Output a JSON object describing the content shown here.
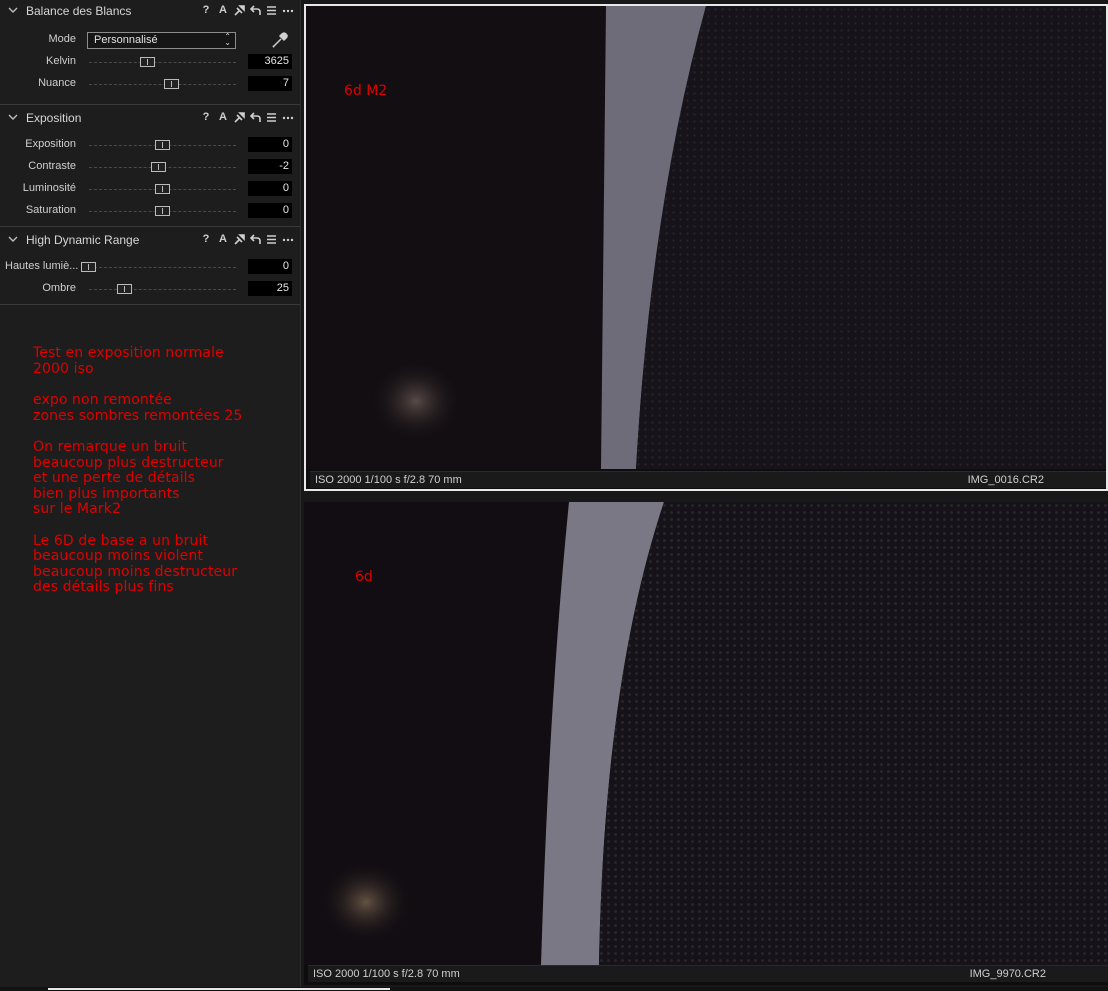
{
  "white_balance": {
    "title": "Balance des Blancs",
    "mode_label": "Mode",
    "mode_value": "Personnalisé",
    "kelvin_label": "Kelvin",
    "kelvin_value": "3625",
    "nuance_label": "Nuance",
    "nuance_value": "7"
  },
  "exposure": {
    "title": "Exposition",
    "exposition_label": "Exposition",
    "exposition_value": "0",
    "contraste_label": "Contraste",
    "contraste_value": "-2",
    "luminosite_label": "Luminosité",
    "luminosite_value": "0",
    "saturation_label": "Saturation",
    "saturation_value": "0"
  },
  "hdr": {
    "title": "High Dynamic Range",
    "hautes_label": "Hautes lumiè...",
    "hautes_value": "0",
    "ombre_label": "Ombre",
    "ombre_value": "25"
  },
  "tool_icons": [
    "help-icon",
    "auto-icon",
    "copy-apply-icon",
    "reset-icon",
    "menu-icon",
    "more-icon"
  ],
  "tool_icon_text": {
    "help": "?",
    "auto": "A"
  },
  "notes": [
    [
      "Test en exposition normale",
      "2000 iso"
    ],
    [
      "expo non remontée",
      "zones sombres remontées 25"
    ],
    [
      "On remarque un bruit",
      "beaucoup plus destructeur",
      "et une perte de détails",
      "bien plus importants",
      "sur le Mark2"
    ],
    [
      "Le 6D de base a un bruit",
      "beaucoup moins violent",
      "beaucoup moins destructeur",
      "des détails plus fins"
    ]
  ],
  "viewer_top": {
    "label": "6d M2",
    "exif": "ISO 2000  1/100 s  f/2.8  70 mm",
    "filename": "IMG_0016.CR2"
  },
  "viewer_bottom": {
    "label": "6d",
    "exif": "ISO 2000  1/100 s  f/2.8  70 mm",
    "filename": "IMG_9970.CR2"
  },
  "colors": {
    "annotation": "#e00000",
    "panel_bg": "#1d1d1d",
    "value_bg": "#000000"
  }
}
